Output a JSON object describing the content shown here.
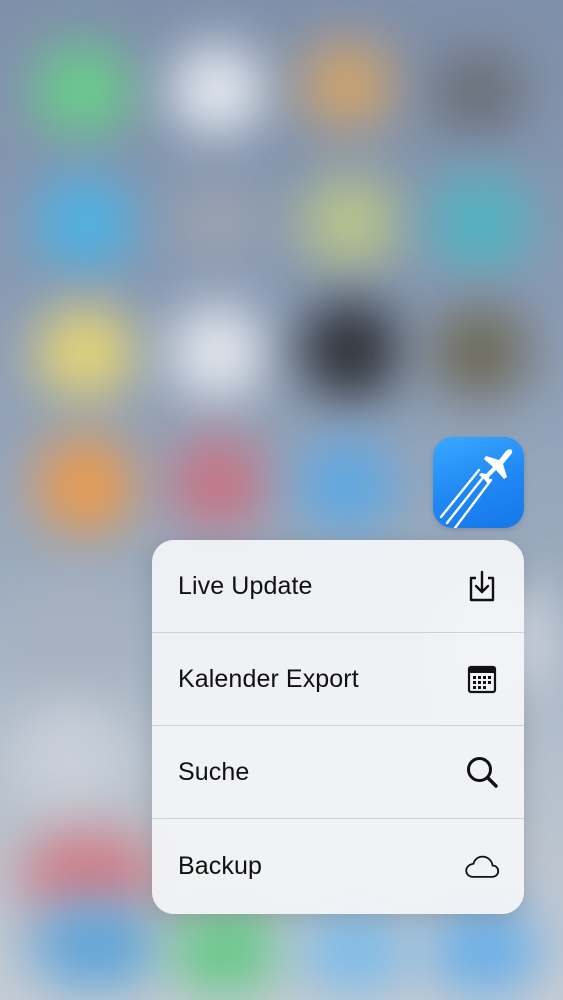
{
  "background": {
    "colors": {
      "base": "#8193ad",
      "app_icon_blue": "#1f87f5"
    }
  },
  "app_icon": {
    "icon": "airplane-trails-icon"
  },
  "quick_actions": {
    "items": [
      {
        "label": "Live Update",
        "icon": "download-tray-icon"
      },
      {
        "label": "Kalender Export",
        "icon": "calendar-icon"
      },
      {
        "label": "Suche",
        "icon": "search-icon"
      },
      {
        "label": "Backup",
        "icon": "cloud-icon"
      }
    ]
  }
}
